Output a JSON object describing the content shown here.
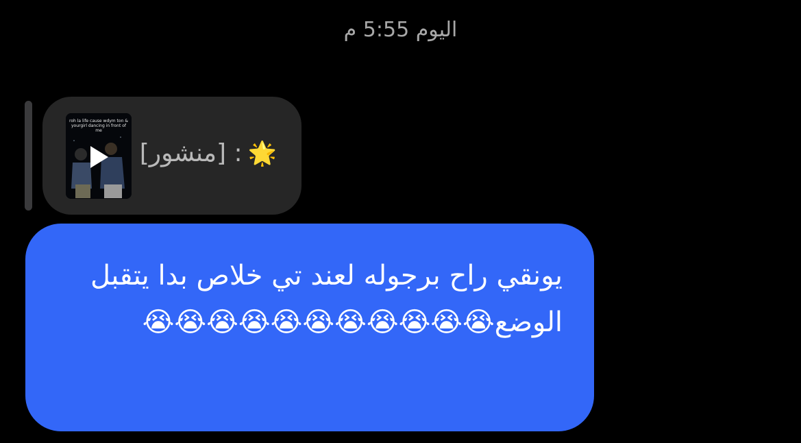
{
  "header": {
    "timestamp": "اليوم 5:55 م"
  },
  "quoted_post": {
    "star_emoji": "🌟",
    "label": ": [منشور]",
    "thumbnail_caption": "roh la life cause wdym ton & yourgirl dancing in front of me"
  },
  "message": {
    "text": "يونقي راح برجوله لعند تي خلاص بدا يتقبل الوضع😭😭😭😭😭😭😭😭😭😭😭"
  },
  "colors": {
    "background": "#000000",
    "quoted_bubble": "#262626",
    "message_bubble": "#3367f8",
    "timestamp_text": "#a8a8a8"
  }
}
